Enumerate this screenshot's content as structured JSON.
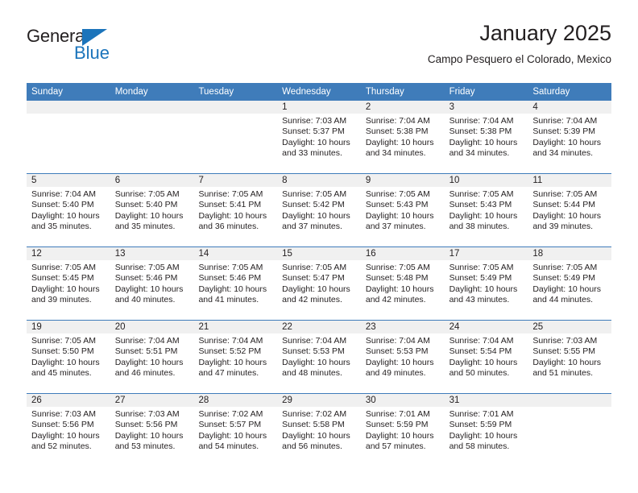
{
  "brand": {
    "name_top": "General",
    "name_bottom": "Blue",
    "color_blue": "#1b74bb",
    "color_dark": "#231f20",
    "triangle_icon": "triangle-icon"
  },
  "header": {
    "title": "January 2025",
    "subtitle": "Campo Pesquero el Colorado, Mexico"
  },
  "calendar": {
    "header_bg": "#3f7cba",
    "daynum_bg": "#f0f0f0",
    "weekdays": [
      "Sunday",
      "Monday",
      "Tuesday",
      "Wednesday",
      "Thursday",
      "Friday",
      "Saturday"
    ],
    "weeks": [
      [
        {
          "day": ""
        },
        {
          "day": ""
        },
        {
          "day": ""
        },
        {
          "day": "1",
          "sunrise": "Sunrise: 7:03 AM",
          "sunset": "Sunset: 5:37 PM",
          "daylight1": "Daylight: 10 hours",
          "daylight2": "and 33 minutes."
        },
        {
          "day": "2",
          "sunrise": "Sunrise: 7:04 AM",
          "sunset": "Sunset: 5:38 PM",
          "daylight1": "Daylight: 10 hours",
          "daylight2": "and 34 minutes."
        },
        {
          "day": "3",
          "sunrise": "Sunrise: 7:04 AM",
          "sunset": "Sunset: 5:38 PM",
          "daylight1": "Daylight: 10 hours",
          "daylight2": "and 34 minutes."
        },
        {
          "day": "4",
          "sunrise": "Sunrise: 7:04 AM",
          "sunset": "Sunset: 5:39 PM",
          "daylight1": "Daylight: 10 hours",
          "daylight2": "and 34 minutes."
        }
      ],
      [
        {
          "day": "5",
          "sunrise": "Sunrise: 7:04 AM",
          "sunset": "Sunset: 5:40 PM",
          "daylight1": "Daylight: 10 hours",
          "daylight2": "and 35 minutes."
        },
        {
          "day": "6",
          "sunrise": "Sunrise: 7:05 AM",
          "sunset": "Sunset: 5:40 PM",
          "daylight1": "Daylight: 10 hours",
          "daylight2": "and 35 minutes."
        },
        {
          "day": "7",
          "sunrise": "Sunrise: 7:05 AM",
          "sunset": "Sunset: 5:41 PM",
          "daylight1": "Daylight: 10 hours",
          "daylight2": "and 36 minutes."
        },
        {
          "day": "8",
          "sunrise": "Sunrise: 7:05 AM",
          "sunset": "Sunset: 5:42 PM",
          "daylight1": "Daylight: 10 hours",
          "daylight2": "and 37 minutes."
        },
        {
          "day": "9",
          "sunrise": "Sunrise: 7:05 AM",
          "sunset": "Sunset: 5:43 PM",
          "daylight1": "Daylight: 10 hours",
          "daylight2": "and 37 minutes."
        },
        {
          "day": "10",
          "sunrise": "Sunrise: 7:05 AM",
          "sunset": "Sunset: 5:43 PM",
          "daylight1": "Daylight: 10 hours",
          "daylight2": "and 38 minutes."
        },
        {
          "day": "11",
          "sunrise": "Sunrise: 7:05 AM",
          "sunset": "Sunset: 5:44 PM",
          "daylight1": "Daylight: 10 hours",
          "daylight2": "and 39 minutes."
        }
      ],
      [
        {
          "day": "12",
          "sunrise": "Sunrise: 7:05 AM",
          "sunset": "Sunset: 5:45 PM",
          "daylight1": "Daylight: 10 hours",
          "daylight2": "and 39 minutes."
        },
        {
          "day": "13",
          "sunrise": "Sunrise: 7:05 AM",
          "sunset": "Sunset: 5:46 PM",
          "daylight1": "Daylight: 10 hours",
          "daylight2": "and 40 minutes."
        },
        {
          "day": "14",
          "sunrise": "Sunrise: 7:05 AM",
          "sunset": "Sunset: 5:46 PM",
          "daylight1": "Daylight: 10 hours",
          "daylight2": "and 41 minutes."
        },
        {
          "day": "15",
          "sunrise": "Sunrise: 7:05 AM",
          "sunset": "Sunset: 5:47 PM",
          "daylight1": "Daylight: 10 hours",
          "daylight2": "and 42 minutes."
        },
        {
          "day": "16",
          "sunrise": "Sunrise: 7:05 AM",
          "sunset": "Sunset: 5:48 PM",
          "daylight1": "Daylight: 10 hours",
          "daylight2": "and 42 minutes."
        },
        {
          "day": "17",
          "sunrise": "Sunrise: 7:05 AM",
          "sunset": "Sunset: 5:49 PM",
          "daylight1": "Daylight: 10 hours",
          "daylight2": "and 43 minutes."
        },
        {
          "day": "18",
          "sunrise": "Sunrise: 7:05 AM",
          "sunset": "Sunset: 5:49 PM",
          "daylight1": "Daylight: 10 hours",
          "daylight2": "and 44 minutes."
        }
      ],
      [
        {
          "day": "19",
          "sunrise": "Sunrise: 7:05 AM",
          "sunset": "Sunset: 5:50 PM",
          "daylight1": "Daylight: 10 hours",
          "daylight2": "and 45 minutes."
        },
        {
          "day": "20",
          "sunrise": "Sunrise: 7:04 AM",
          "sunset": "Sunset: 5:51 PM",
          "daylight1": "Daylight: 10 hours",
          "daylight2": "and 46 minutes."
        },
        {
          "day": "21",
          "sunrise": "Sunrise: 7:04 AM",
          "sunset": "Sunset: 5:52 PM",
          "daylight1": "Daylight: 10 hours",
          "daylight2": "and 47 minutes."
        },
        {
          "day": "22",
          "sunrise": "Sunrise: 7:04 AM",
          "sunset": "Sunset: 5:53 PM",
          "daylight1": "Daylight: 10 hours",
          "daylight2": "and 48 minutes."
        },
        {
          "day": "23",
          "sunrise": "Sunrise: 7:04 AM",
          "sunset": "Sunset: 5:53 PM",
          "daylight1": "Daylight: 10 hours",
          "daylight2": "and 49 minutes."
        },
        {
          "day": "24",
          "sunrise": "Sunrise: 7:04 AM",
          "sunset": "Sunset: 5:54 PM",
          "daylight1": "Daylight: 10 hours",
          "daylight2": "and 50 minutes."
        },
        {
          "day": "25",
          "sunrise": "Sunrise: 7:03 AM",
          "sunset": "Sunset: 5:55 PM",
          "daylight1": "Daylight: 10 hours",
          "daylight2": "and 51 minutes."
        }
      ],
      [
        {
          "day": "26",
          "sunrise": "Sunrise: 7:03 AM",
          "sunset": "Sunset: 5:56 PM",
          "daylight1": "Daylight: 10 hours",
          "daylight2": "and 52 minutes."
        },
        {
          "day": "27",
          "sunrise": "Sunrise: 7:03 AM",
          "sunset": "Sunset: 5:56 PM",
          "daylight1": "Daylight: 10 hours",
          "daylight2": "and 53 minutes."
        },
        {
          "day": "28",
          "sunrise": "Sunrise: 7:02 AM",
          "sunset": "Sunset: 5:57 PM",
          "daylight1": "Daylight: 10 hours",
          "daylight2": "and 54 minutes."
        },
        {
          "day": "29",
          "sunrise": "Sunrise: 7:02 AM",
          "sunset": "Sunset: 5:58 PM",
          "daylight1": "Daylight: 10 hours",
          "daylight2": "and 56 minutes."
        },
        {
          "day": "30",
          "sunrise": "Sunrise: 7:01 AM",
          "sunset": "Sunset: 5:59 PM",
          "daylight1": "Daylight: 10 hours",
          "daylight2": "and 57 minutes."
        },
        {
          "day": "31",
          "sunrise": "Sunrise: 7:01 AM",
          "sunset": "Sunset: 5:59 PM",
          "daylight1": "Daylight: 10 hours",
          "daylight2": "and 58 minutes."
        },
        {
          "day": ""
        }
      ]
    ]
  }
}
